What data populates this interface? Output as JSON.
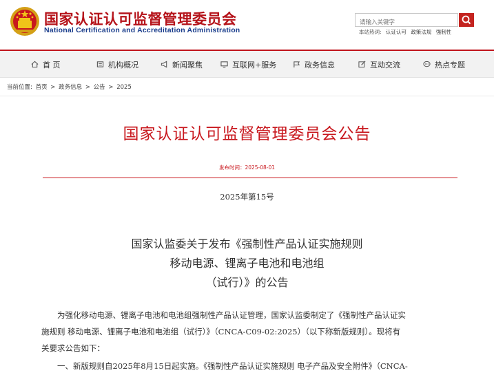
{
  "site": {
    "name_cn": "国家认证认可监督管理委员会",
    "name_en": "National Certification and Accreditation Administration"
  },
  "search": {
    "placeholder": "请输入关键字",
    "hot_label": "本站热词:",
    "hot_terms": [
      "认证认可",
      "政策法规",
      "强制性"
    ]
  },
  "nav": {
    "items": [
      {
        "label": "首 页",
        "icon": "home-icon"
      },
      {
        "label": "机构概况",
        "icon": "building-icon"
      },
      {
        "label": "新闻聚焦",
        "icon": "megaphone-icon"
      },
      {
        "label": "互联网+服务",
        "icon": "monitor-icon"
      },
      {
        "label": "政务信息",
        "icon": "flag-icon"
      },
      {
        "label": "互动交流",
        "icon": "edit-icon"
      },
      {
        "label": "热点专题",
        "icon": "chat-icon"
      }
    ]
  },
  "breadcrumb": {
    "prefix": "当前位置:",
    "items": [
      "首页",
      "政务信息",
      "公告",
      "2025"
    ],
    "sep": ">"
  },
  "article": {
    "title": "国家认证认可监督管理委员会公告",
    "publish_time": "发布时间：2025-08-01",
    "doc_number": "2025年第15号",
    "subtitle_lines": [
      "国家认监委关于发布《强制性产品认证实施规则",
      "移动电源、锂离子电池和电池组",
      "（试行）》的公告"
    ],
    "paragraphs": [
      "　　为强化移动电源、锂离子电池和电池组强制性产品认证管理，国家认监委制定了《强制性产品认证实",
      "施规则 移动电源、锂离子电池和电池组（试行）》（CNCA-C09-02:2025）（以下称新版规则）。现将有",
      "关要求公告如下：",
      "　　一、新版规则自2025年8月15日起实施。《强制性产品认证实施规则 电子产品及安全附件》（CNCA-"
    ]
  },
  "colors": {
    "brand_red": "#c8171d",
    "brand_blue": "#1a3d8c",
    "nav_bg": "#f2f2f2"
  }
}
